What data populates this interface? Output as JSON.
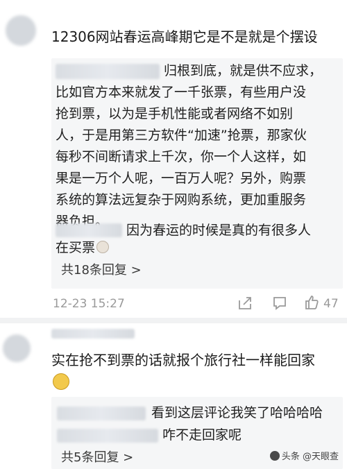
{
  "comment1": {
    "text": "12306网站春运高峰期它是不是就是个摆设",
    "replies": [
      {
        "lines": [
          "归根到底，就是供不应求，",
          "比如官方本来就发了一千张票，有些用户没",
          "抢到票，以为是手机性能或者网络不如别",
          "人，于是用第三方软件“加速”抢票，那家伙",
          "每秒不间断请求上千次，你一个人这样，如",
          "果是一万个人呢，一百万人呢？另外，购票",
          "系统的算法远复杂于网购系统，更加重服务",
          "器负担。"
        ]
      },
      {
        "lines": [
          "因为春运的时候是真的有很多人",
          "在买票"
        ],
        "emoji": "laughing-tears-emoji"
      }
    ],
    "more_replies": "共18条回复 >",
    "timestamp": "12-23 15:27",
    "likes": "47",
    "icons": [
      "share-icon",
      "comment-icon",
      "like-icon"
    ]
  },
  "comment2": {
    "lines": [
      "实在抢不到票的话就报个旅行社一样能回家"
    ],
    "emoji": "shrug-emoji",
    "replies": [
      {
        "text": "看到这层评论我笑了哈哈哈哈"
      },
      {
        "text": "咋不走回家呢"
      }
    ],
    "more_replies": "共5条回复 >"
  },
  "watermark": "头条 @天眼查",
  "colors": {
    "reply_bg": "#f5f6f7",
    "meta_gray": "#9a9a9a",
    "text": "#1a1a1a"
  }
}
